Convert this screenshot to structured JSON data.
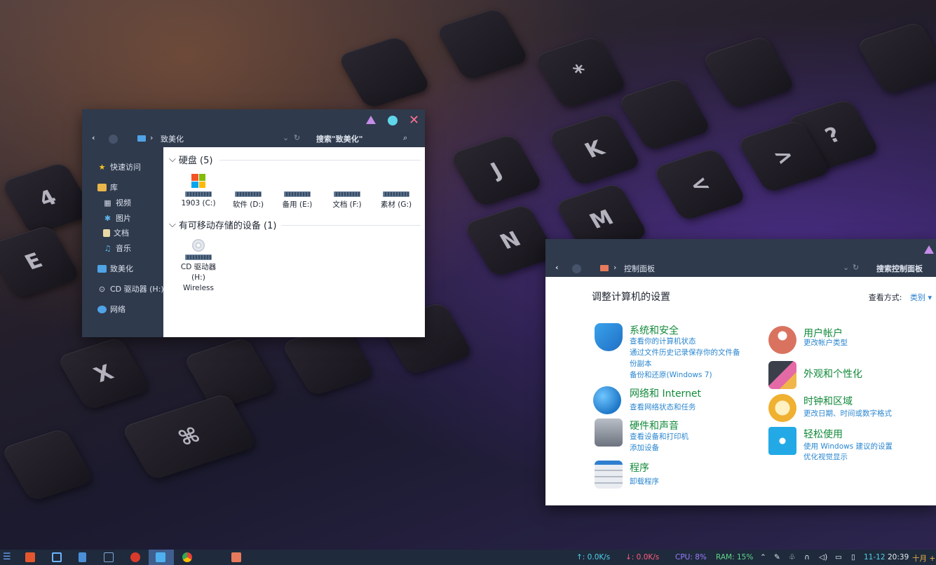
{
  "explorer": {
    "breadcrumb": "致美化",
    "search_placeholder": "搜索\"致美化\"",
    "sidebar": [
      {
        "label": "快速访问",
        "icon": "star-icon"
      },
      {
        "label": "库",
        "icon": "library-icon"
      },
      {
        "label": "视频",
        "icon": "video-icon"
      },
      {
        "label": "图片",
        "icon": "picture-icon"
      },
      {
        "label": "文档",
        "icon": "document-icon"
      },
      {
        "label": "音乐",
        "icon": "music-icon"
      },
      {
        "label": "致美化",
        "icon": "computer-icon"
      },
      {
        "label": "CD 驱动器 (H:)",
        "icon": "cd-drive-icon"
      },
      {
        "label": "网络",
        "icon": "network-icon"
      }
    ],
    "section_disks": "硬盘 (5)",
    "drives": [
      "1903 (C:)",
      "软件 (D:)",
      "备用 (E:)",
      "文档 (F:)",
      "素材 (G:)"
    ],
    "section_removable": "有可移动存储的设备 (1)",
    "cd_drive": {
      "line1": "CD 驱动器",
      "line2": "(H:)",
      "line3": "Wireless"
    }
  },
  "control_panel": {
    "breadcrumb": "控制面板",
    "search_placeholder": "搜索控制面板",
    "heading": "调整计算机的设置",
    "view_by_label": "查看方式:",
    "view_by_value": "类别",
    "categories_left": [
      {
        "title": "系统和安全",
        "links": [
          "查看你的计算机状态",
          "通过文件历史记录保存你的文件备",
          "份副本",
          "备份和还原(Windows 7)"
        ],
        "icon": "security-shield-icon"
      },
      {
        "title": "网络和 Internet",
        "links": [
          "查看网络状态和任务"
        ],
        "icon": "globe-icon"
      },
      {
        "title": "硬件和声音",
        "links": [
          "查看设备和打印机",
          "添加设备"
        ],
        "icon": "printer-speaker-icon"
      },
      {
        "title": "程序",
        "links": [
          "卸载程序"
        ],
        "icon": "programs-icon"
      }
    ],
    "categories_right": [
      {
        "title": "用户帐户",
        "links": [
          "更改帐户类型"
        ],
        "icon": "user-account-icon"
      },
      {
        "title": "外观和个性化",
        "links": [],
        "icon": "appearance-icon"
      },
      {
        "title": "时钟和区域",
        "links": [
          "更改日期、时间或数字格式"
        ],
        "icon": "clock-region-icon"
      },
      {
        "title": "轻松使用",
        "links": [
          "使用 Windows 建议的设置",
          "优化视觉显示"
        ],
        "icon": "ease-of-access-icon"
      }
    ]
  },
  "taskbar": {
    "upload": "↑: 0.0K/s",
    "download": "↓: 0.0K/s",
    "cpu": "CPU: 8%",
    "ram": "RAM: 15%",
    "date": "11-12",
    "time": "20:39",
    "weekday": "十月 +"
  },
  "colors": {
    "window_titlebar": "#2f3a4c",
    "taskbar": "#1f2a3c",
    "cp_category_title": "#128a3a",
    "cp_link": "#2a86cf"
  }
}
